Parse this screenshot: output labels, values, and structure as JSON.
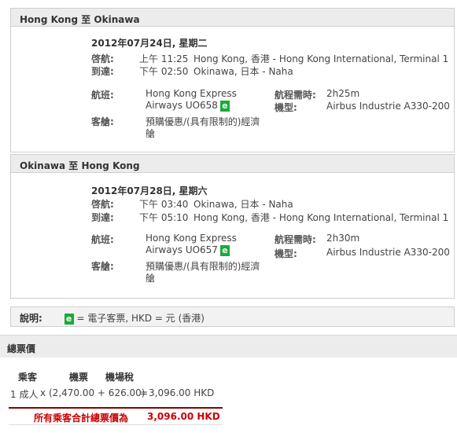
{
  "legs": [
    {
      "title": "Hong Kong 至 Okinawa",
      "date": "2012年07月24日, 星期二",
      "depart_label": "啓航:",
      "depart_time": "上午 11:25",
      "depart_place": "Hong Kong, 香港 - Hong Kong International, Terminal 1",
      "arrive_label": "到達:",
      "arrive_time": "下午 02:50",
      "arrive_place": "Okinawa, 日本 - Naha",
      "flight_label": "航班:",
      "flight_line1": "Hong Kong Express",
      "flight_line2": "Airways UO658",
      "eticket": "e",
      "duration_label": "航程需時:",
      "duration": "2h25m",
      "aircraft_label": "機型:",
      "aircraft": "Airbus Industrie A330-200",
      "cabin_label": "客艙:",
      "cabin_line1": "預購優惠/(具有限制的)經濟",
      "cabin_line2": "艙"
    },
    {
      "title": "Okinawa 至 Hong Kong",
      "date": "2012年07月28日, 星期六",
      "depart_label": "啓航:",
      "depart_time": "下午 03:40",
      "depart_place": "Okinawa, 日本 - Naha",
      "arrive_label": "到達:",
      "arrive_time": "下午 05:10",
      "arrive_place": "Hong Kong, 香港 - Hong Kong International, Terminal 1",
      "flight_label": "航班:",
      "flight_line1": "Hong Kong Express",
      "flight_line2": "Airways UO657",
      "eticket": "e",
      "duration_label": "航程需時:",
      "duration": "2h30m",
      "aircraft_label": "機型:",
      "aircraft": "Airbus Industrie A330-200",
      "cabin_label": "客艙:",
      "cabin_line1": "預購優惠/(具有限制的)經濟",
      "cabin_line2": "艙"
    }
  ],
  "legend": {
    "label": "說明:",
    "eticket": "e",
    "text": "= 電子客票,  HKD = 元 (香港)"
  },
  "fare": {
    "title": "總票價",
    "col_passenger": "乘客",
    "col_fare": "機票",
    "col_tax": "機場稅",
    "row_pax": "1 成人",
    "row_x": "x",
    "row_calc": "(2,470.00 + 626.00)",
    "row_eq": "=",
    "row_total": "3,096.00 HKD",
    "sum_label": "所有乘客合計總票價為",
    "sum_value": "3,096.00 HKD"
  },
  "colors": {
    "eticket_green": "#1aaa3a",
    "total_red": "#cc0000",
    "header_gray": "#ececec"
  }
}
